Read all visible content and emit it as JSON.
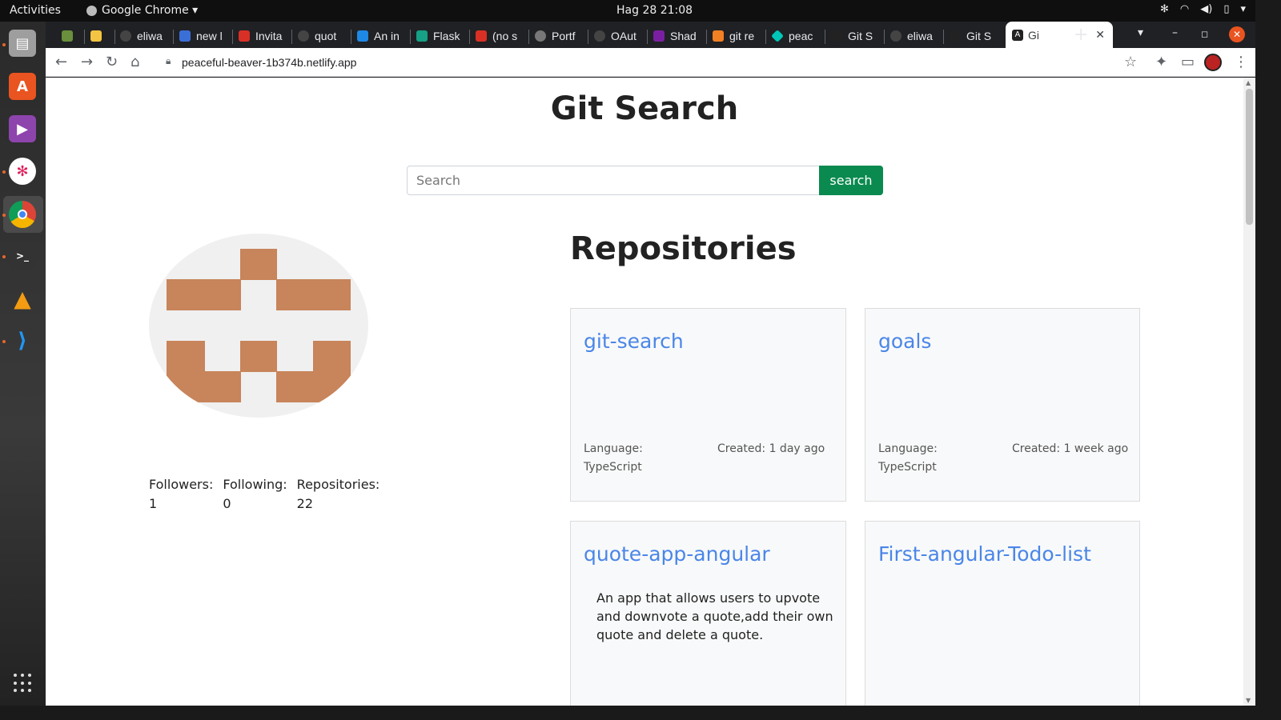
{
  "system": {
    "activities": "Activities",
    "app_name": "Google Chrome ▾",
    "clock": "Hag 28  21:08"
  },
  "browser": {
    "tabs": [
      "",
      "",
      "eliwa",
      "new l",
      "Invita",
      "quot",
      "An in",
      "Flask",
      "(no s",
      "Portf",
      "OAut",
      "Shad",
      "git re",
      "peac",
      "Git S",
      "eliwa",
      "Git S"
    ],
    "active_tab": "Gi",
    "url": "peaceful-beaver-1b374b.netlify.app"
  },
  "page": {
    "title": "Git Search",
    "search_placeholder": "Search",
    "search_button": "search",
    "profile": {
      "followers_label": "Followers:",
      "followers": "1",
      "following_label": "Following:",
      "following": "0",
      "repos_label": "Repositories:",
      "repos": "22"
    },
    "repos_heading": "Repositories",
    "repos": [
      {
        "name": "git-search",
        "language_label": "Language:",
        "language": "TypeScript",
        "created": "Created: 1 day ago",
        "description": ""
      },
      {
        "name": "goals",
        "language_label": "Language:",
        "language": "TypeScript",
        "created": "Created: 1 week ago",
        "description": ""
      },
      {
        "name": "quote-app-angular",
        "language_label": "",
        "language": "",
        "created": "",
        "description": "An app that allows users to upvote and downvote a quote,add their own quote and delete a quote."
      },
      {
        "name": "First-angular-Todo-list",
        "language_label": "",
        "language": "",
        "created": "",
        "description": ""
      }
    ]
  },
  "colors": {
    "accent_green": "#0a8a4f",
    "link_blue": "#4a86e8",
    "identicon": "#c8845a"
  }
}
